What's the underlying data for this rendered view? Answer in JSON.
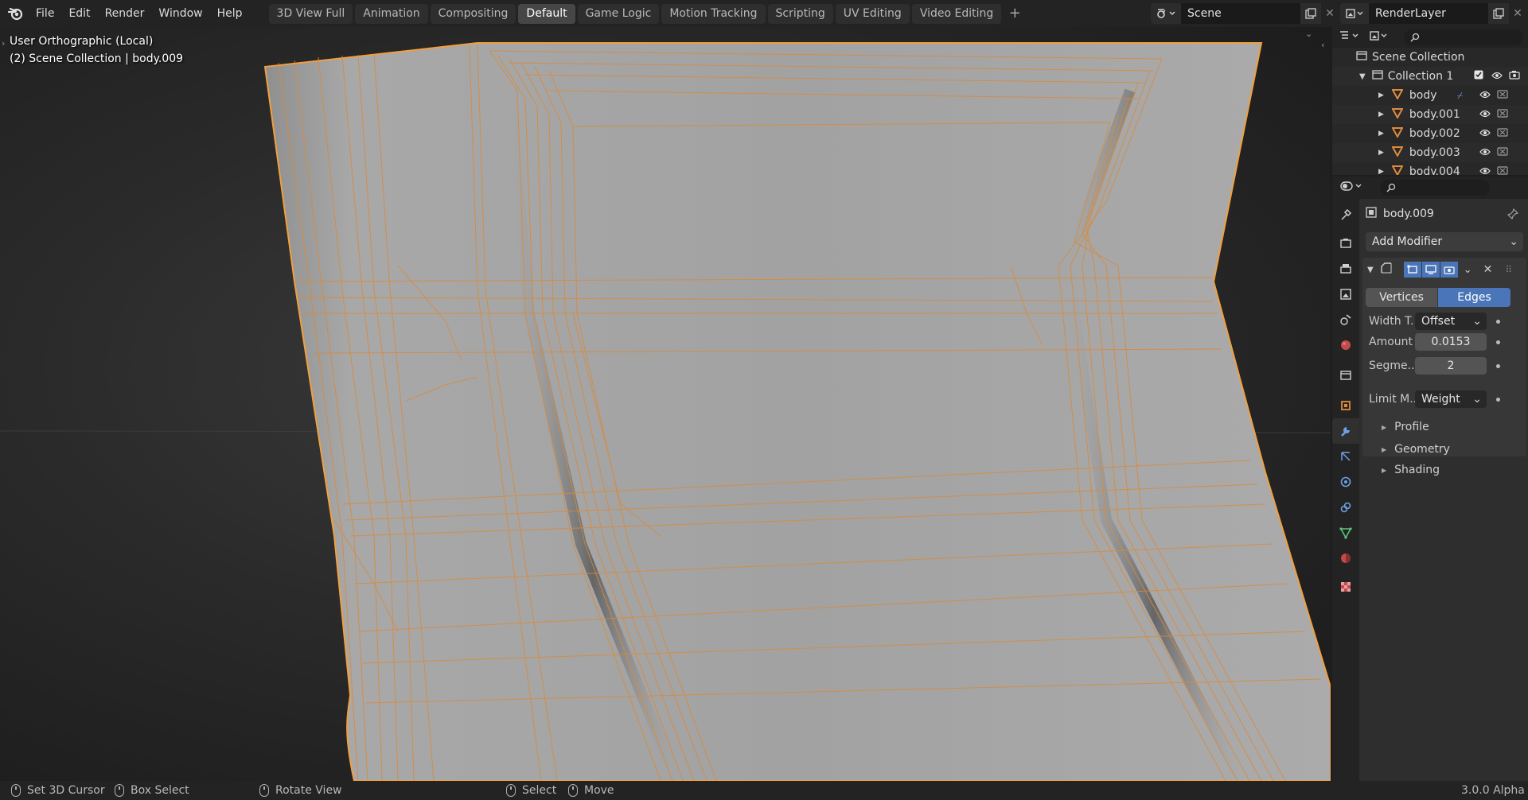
{
  "menu": {
    "items": [
      "File",
      "Edit",
      "Render",
      "Window",
      "Help"
    ]
  },
  "workspaces": {
    "tabs": [
      "3D View Full",
      "Animation",
      "Compositing",
      "Default",
      "Game Logic",
      "Motion Tracking",
      "Scripting",
      "UV Editing",
      "Video Editing"
    ],
    "active": "Default",
    "add_label": "+"
  },
  "scene": {
    "name": "Scene"
  },
  "render_layer": {
    "name": "RenderLayer"
  },
  "viewport": {
    "view_label": "User Orthographic (Local)",
    "collection_label": "(2) Scene Collection | body.009"
  },
  "outliner": {
    "root": "Scene Collection",
    "collection": "Collection 1",
    "objects": [
      "body",
      "body.001",
      "body.002",
      "body.003",
      "body.004"
    ]
  },
  "properties": {
    "object_name": "body.009",
    "add_modifier_label": "Add Modifier",
    "modifier": {
      "mode_options": [
        "Vertices",
        "Edges"
      ],
      "mode_selected": "Edges",
      "width_type_label": "Width T...",
      "width_type_value": "Offset",
      "amount_label": "Amount",
      "amount_value": "0.0153",
      "segments_label": "Segme...",
      "segments_value": "2",
      "limit_label": "Limit M...",
      "limit_value": "Weight",
      "subpanels": [
        "Profile",
        "Geometry",
        "Shading"
      ]
    }
  },
  "statusbar": {
    "items": [
      "Set 3D Cursor",
      "Box Select",
      "Rotate View",
      "Select",
      "Move"
    ],
    "version": "3.0.0 Alpha"
  },
  "colors": {
    "accent": "#4a75b8",
    "selection_outline": "#f0a040",
    "wire": "#d98a3a",
    "mesh_fill": "#a5a5a5",
    "object_icon": "#e08a3c"
  }
}
